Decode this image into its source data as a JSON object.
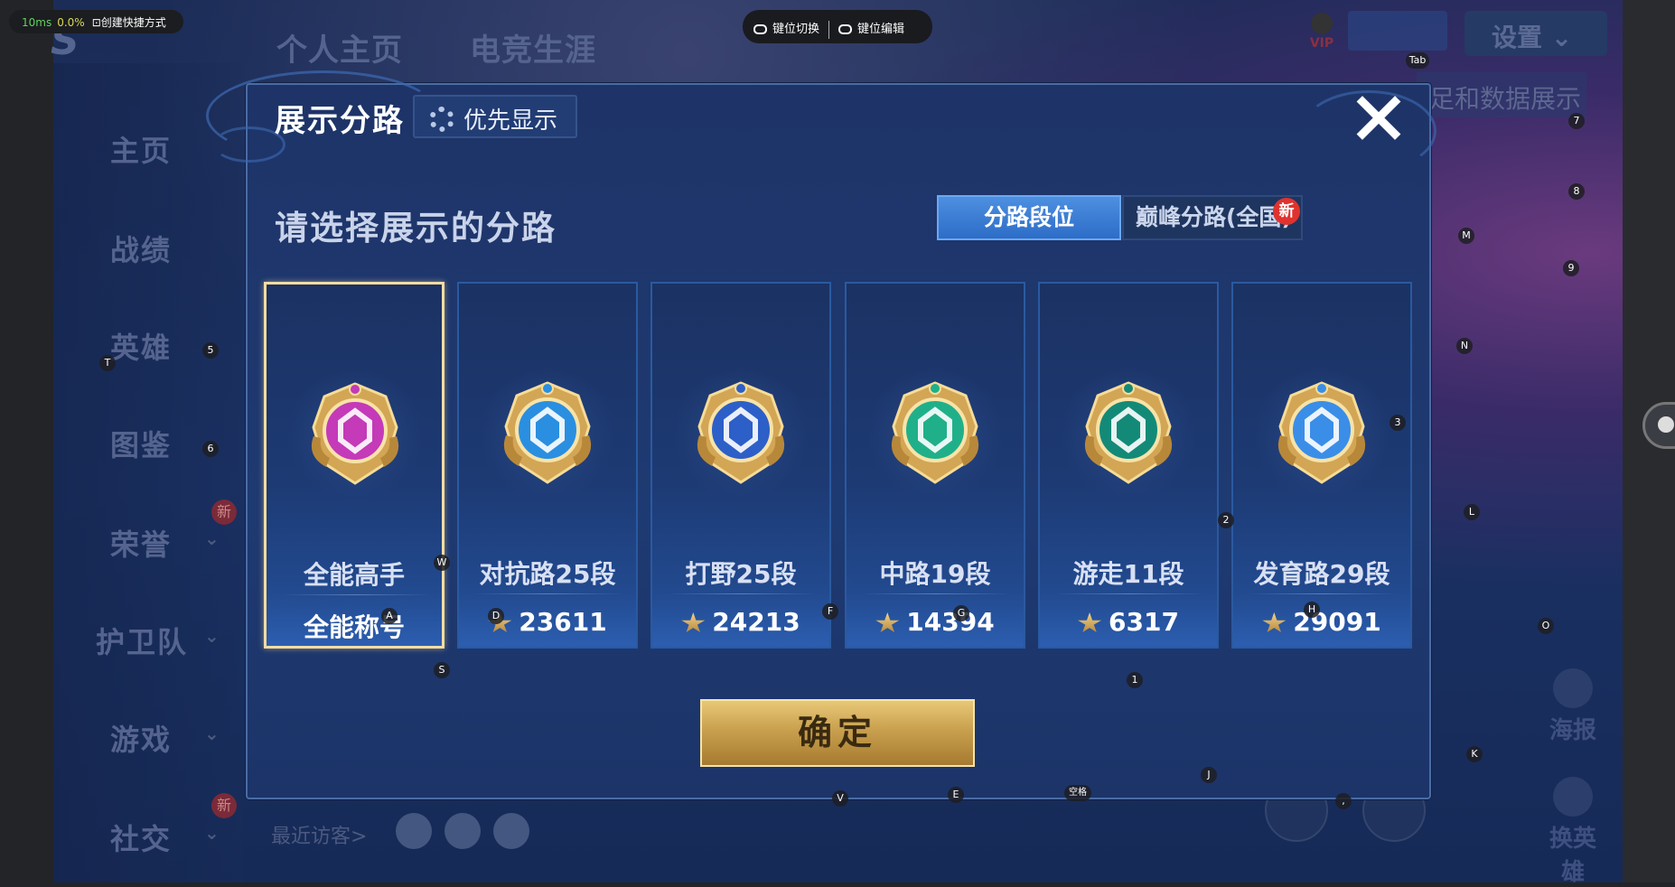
{
  "overlay": {
    "latency": "10ms",
    "cpu": "0.0%",
    "shortcut_label": "创建快捷方式",
    "key_switch": "键位切换",
    "key_edit": "键位编辑"
  },
  "background": {
    "top_tabs": [
      "个人主页",
      "电竞生涯"
    ],
    "sidebar": [
      "主页",
      "战绩",
      "英雄",
      "图鉴",
      "荣誉",
      "护卫队",
      "游戏",
      "社交"
    ],
    "new_badge": "新",
    "settings": "设置",
    "vip": "VIP",
    "right_text": "足和数据展示",
    "poster": "海报",
    "switch_hero": "换英雄",
    "recent_visitors": "最近访客>"
  },
  "dialog": {
    "title": "展示分路",
    "priority_button": "优先显示",
    "subtitle": "请选择展示的分路",
    "tabs": [
      "分路段位",
      "巅峰分路(全国)"
    ],
    "tab_new": "新",
    "confirm": "确定",
    "cards": [
      {
        "name": "全能高手",
        "value": "全能称号",
        "selected": true,
        "color": "#c43ab8"
      },
      {
        "name": "对抗路25段",
        "value": "23611",
        "selected": false,
        "color": "#2a8fe0"
      },
      {
        "name": "打野25段",
        "value": "24213",
        "selected": false,
        "color": "#2d5fc8"
      },
      {
        "name": "中路19段",
        "value": "14394",
        "selected": false,
        "color": "#1fb08a"
      },
      {
        "name": "游走11段",
        "value": "6317",
        "selected": false,
        "color": "#138a78"
      },
      {
        "name": "发育路29段",
        "value": "29091",
        "selected": false,
        "color": "#3a8ee8"
      }
    ]
  },
  "key_labels": {
    "tab": "Tab",
    "k7": "7",
    "k8": "8",
    "m": "M",
    "k9": "9",
    "n": "N",
    "k3": "3",
    "l": "L",
    "k2": "2",
    "o": "O",
    "k": "K",
    "j": "J",
    "comma": ",",
    "space": "空格",
    "e": "E",
    "v": "V",
    "k1": "1",
    "s": "S",
    "w": "W",
    "a": "A",
    "d": "D",
    "f": "F",
    "g": "G",
    "h": "H",
    "t": "T",
    "k5": "5",
    "k6": "6"
  }
}
